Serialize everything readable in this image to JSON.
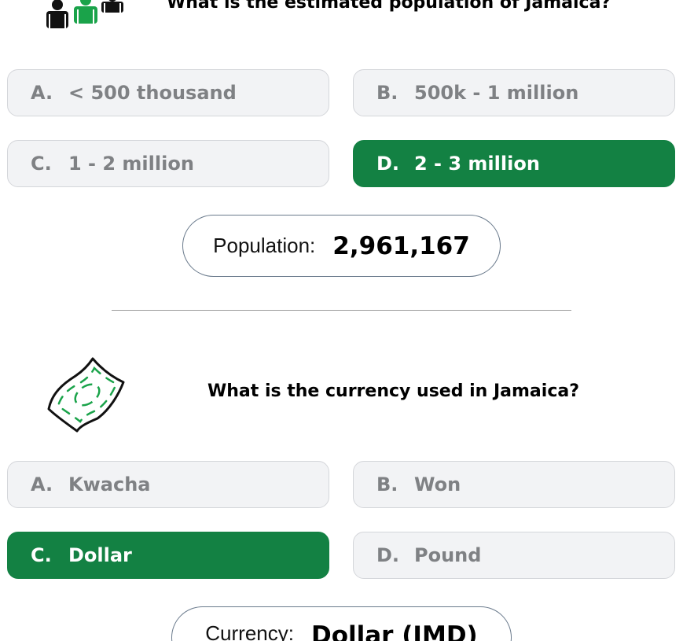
{
  "population_question": {
    "title": "What is the estimated population of Jamaica?",
    "icon": "people-icon",
    "options": [
      {
        "letter": "A.",
        "text": "< 500 thousand"
      },
      {
        "letter": "B.",
        "text": "500k - 1 million"
      },
      {
        "letter": "C.",
        "text": "1 - 2 million"
      },
      {
        "letter": "D.",
        "text": "2 - 3 million"
      }
    ],
    "correct_option": "D.",
    "answer": {
      "label": "Population:",
      "value": "2,961,167"
    }
  },
  "currency_question": {
    "title": "What is the currency used in Jamaica?",
    "icon": "banknote-icon",
    "options": [
      {
        "letter": "A.",
        "text": "Kwacha"
      },
      {
        "letter": "B.",
        "text": "Won"
      },
      {
        "letter": "C.",
        "text": "Dollar"
      },
      {
        "letter": "D.",
        "text": "Pound"
      }
    ],
    "correct_option": "C.",
    "answer": {
      "label": "Currency:",
      "value": "Dollar (JMD)"
    }
  },
  "colors": {
    "correct": "#138143",
    "option_bg": "#f2f3f5",
    "option_text": "#7f8184",
    "icon_green": "#1aa34a"
  }
}
